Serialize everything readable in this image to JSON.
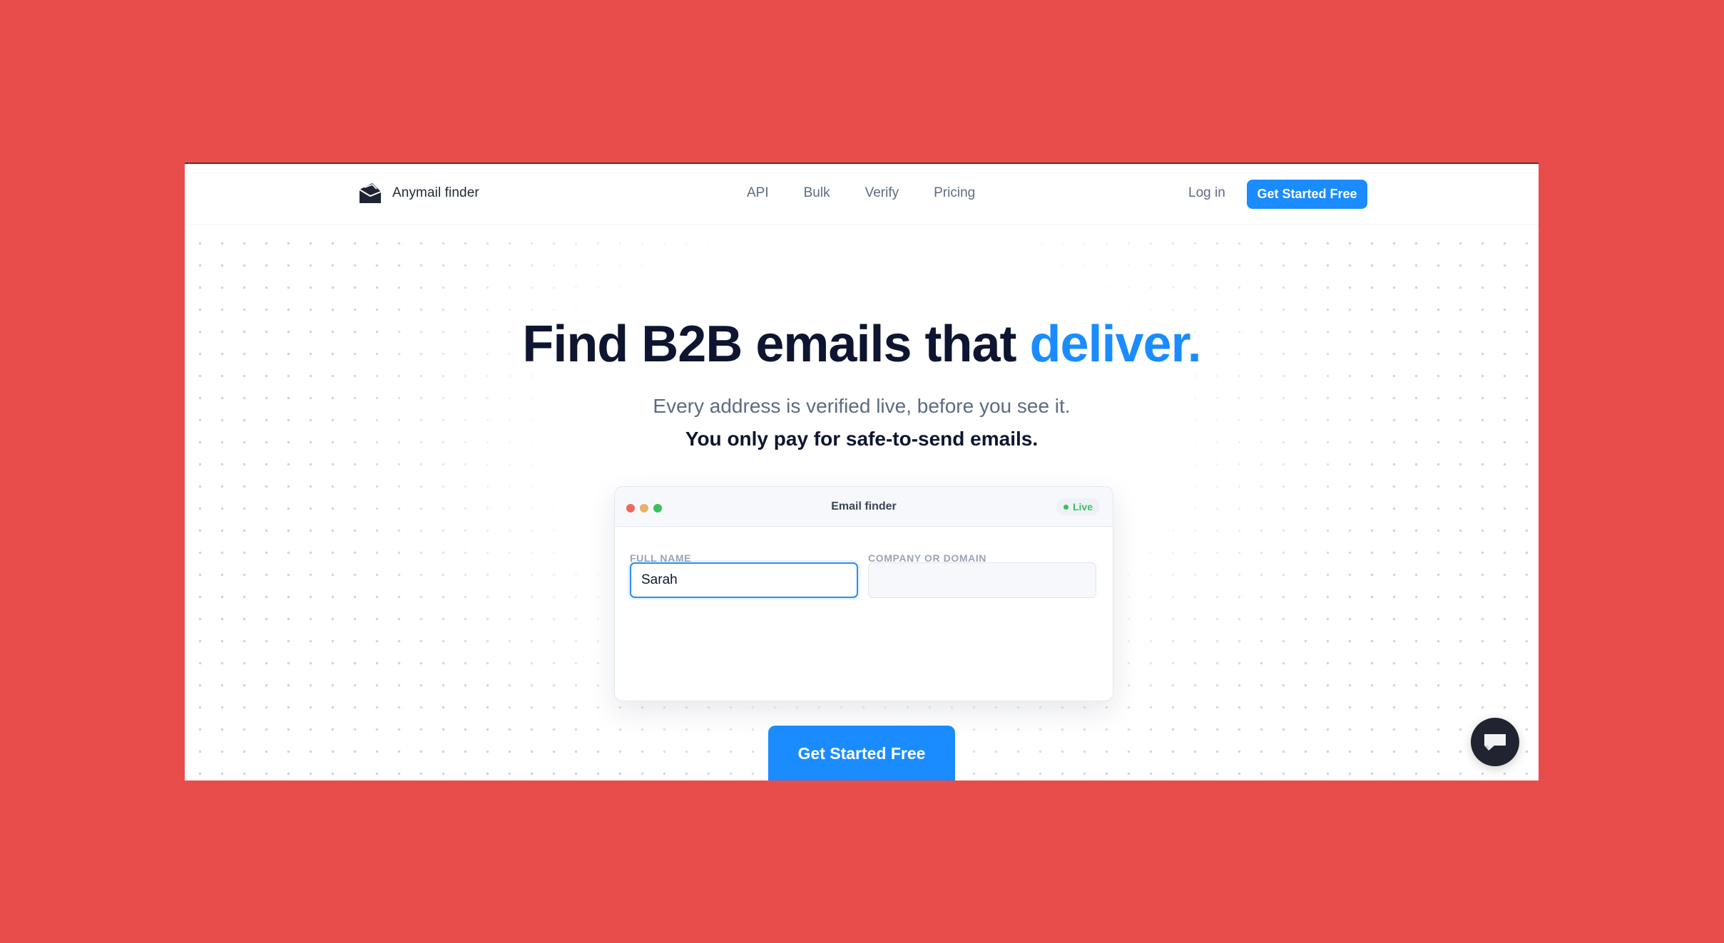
{
  "brand": {
    "name": "Anymail finder",
    "icon": "envelope-logo-icon"
  },
  "nav": {
    "links": [
      "API",
      "Bulk",
      "Verify",
      "Pricing"
    ],
    "login_label": "Log in",
    "cta_label": "Get Started Free"
  },
  "hero": {
    "headline_main": "Find B2B emails that ",
    "headline_accent": "deliver.",
    "subtitle": "Every address is verified live, before you see it.",
    "subtitle_bold": "You only pay for safe-to-send emails.",
    "cta_label": "Get Started Free"
  },
  "finder_card": {
    "title": "Email finder",
    "status_badge": "Live",
    "full_name_label": "FULL NAME",
    "full_name_value": "Sarah",
    "company_label": "COMPANY OR DOMAIN",
    "company_value": ""
  },
  "chat_widget": {
    "icon": "chat-bubble-icon"
  },
  "colors": {
    "background": "#e84d4c",
    "accent": "#1a8cff",
    "heading": "#0d1530",
    "muted": "#5d6b82",
    "live_green": "#3cbf5c"
  }
}
